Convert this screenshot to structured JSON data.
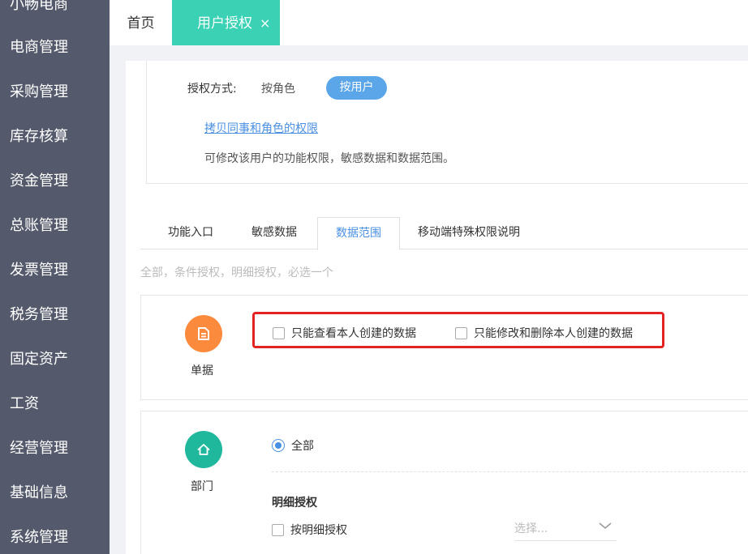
{
  "sidebar": {
    "items": [
      {
        "label": "小畅电商"
      },
      {
        "label": "电商管理"
      },
      {
        "label": "采购管理"
      },
      {
        "label": "库存核算"
      },
      {
        "label": "资金管理"
      },
      {
        "label": "总账管理"
      },
      {
        "label": "发票管理"
      },
      {
        "label": "税务管理"
      },
      {
        "label": "固定资产"
      },
      {
        "label": "工资"
      },
      {
        "label": "经营管理"
      },
      {
        "label": "基础信息"
      },
      {
        "label": "系统管理"
      }
    ]
  },
  "tabbar": {
    "home": "首页",
    "active": "用户授权",
    "close": "×"
  },
  "auth": {
    "label": "授权方式:",
    "by_role": "按角色",
    "by_user": "按用户",
    "copy_link": "拷贝同事和角色的权限",
    "description": "可修改该用户的功能权限，敏感数据和数据范围。"
  },
  "tabs": [
    {
      "label": "功能入口"
    },
    {
      "label": "敏感数据"
    },
    {
      "label": "数据范围"
    },
    {
      "label": "移动端特殊权限说明"
    }
  ],
  "hint": "全部，条件授权，明细授权，必选一个",
  "card_document": {
    "label": "单据",
    "options": [
      {
        "label": "只能查看本人创建的数据",
        "checked": false
      },
      {
        "label": "只能修改和删除本人创建的数据",
        "checked": false
      }
    ]
  },
  "card_department": {
    "label": "部门",
    "radio_label": "全部",
    "section_title": "明细授权",
    "checkbox_label": "按明细授权",
    "select_placeholder": "选择..."
  },
  "colors": {
    "sidebar_bg": "#545a6c",
    "active_tab": "#3ad1b5",
    "accent_blue": "#4a90e2",
    "document_icon": "#fb8a3c",
    "department_icon": "#1fb89c",
    "highlight_red": "#e32222"
  },
  "icons": {
    "document": "document-icon",
    "department": "home-icon",
    "select": "chevron-down-icon"
  }
}
